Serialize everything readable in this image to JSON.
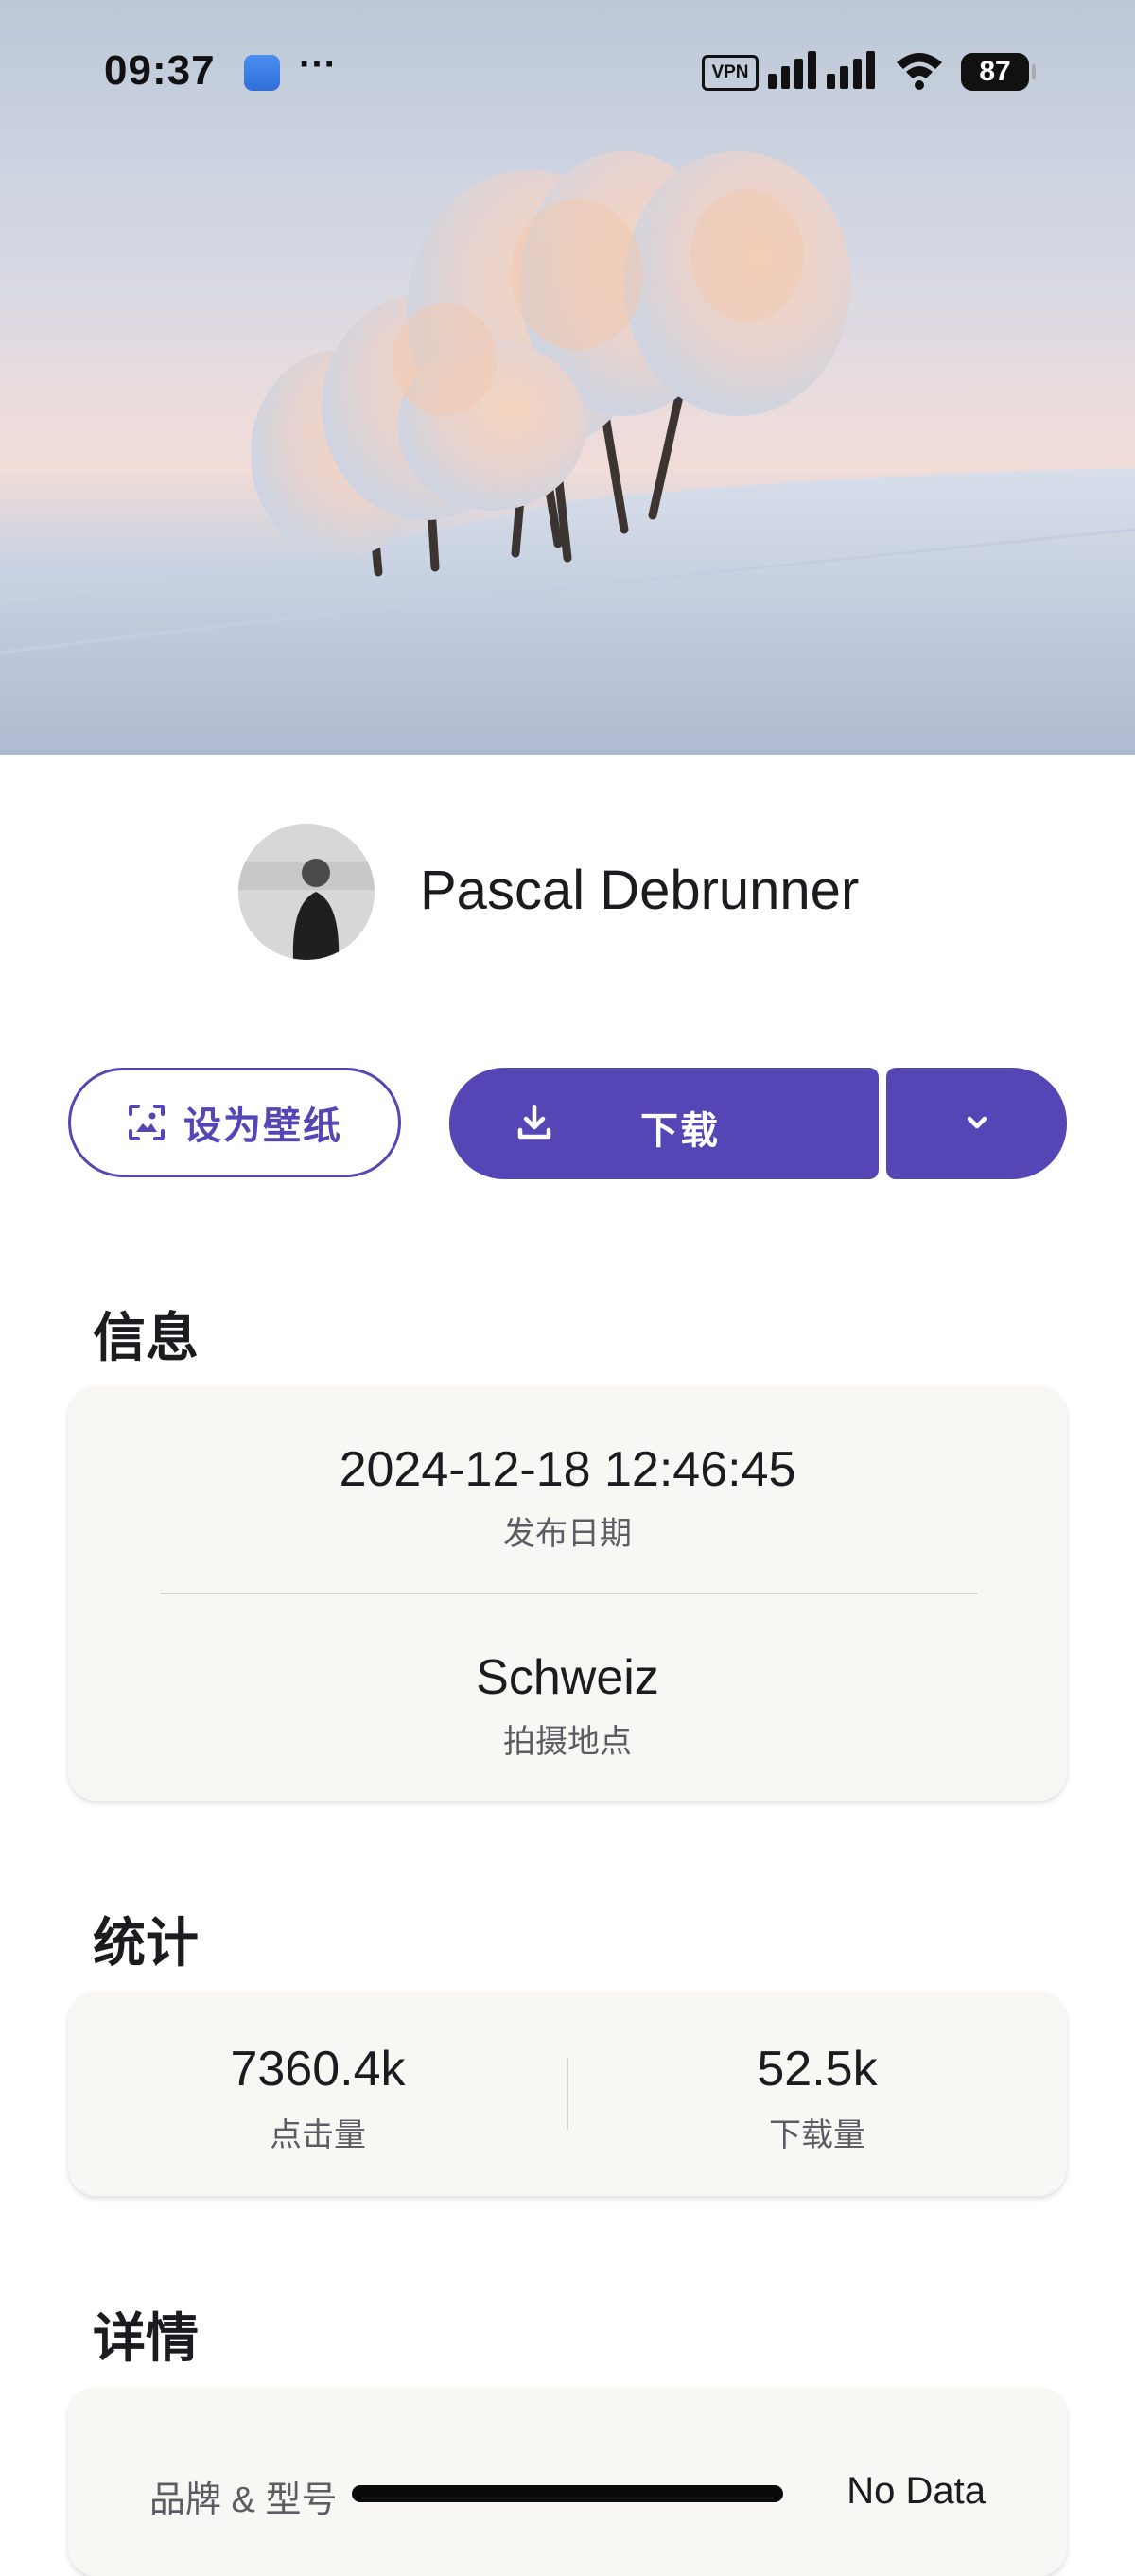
{
  "status_bar": {
    "time": "09:37",
    "app_icon": "photos-app-icon",
    "more_indicator": "···",
    "vpn_label": "VPN",
    "battery_level": "87"
  },
  "hero": {
    "image": "snowy-trees-on-hillside-photo"
  },
  "author": {
    "name": "Pascal Debrunner",
    "avatar": "author-avatar-photo"
  },
  "actions": {
    "set_wallpaper_label": "设为壁纸",
    "download_label": "下载",
    "more_icon": "chevron-down-icon"
  },
  "info": {
    "title": "信息",
    "published_value": "2024-12-18 12:46:45",
    "published_label": "发布日期",
    "location_value": "Schweiz",
    "location_label": "拍摄地点"
  },
  "stats": {
    "title": "统计",
    "views_value": "7360.4k",
    "views_label": "点击量",
    "downloads_value": "52.5k",
    "downloads_label": "下载量"
  },
  "details": {
    "title": "详情",
    "rows": [
      {
        "key": "品牌 & 型号",
        "value": "No Data"
      }
    ]
  },
  "colors": {
    "accent": "#5446b4",
    "card_bg": "#f8f7f3"
  }
}
